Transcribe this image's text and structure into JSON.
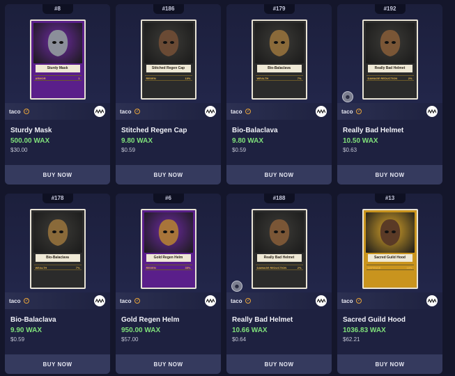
{
  "buy_label": "BUY NOW",
  "collection": "taco",
  "listings": [
    {
      "mint": "#8",
      "title": "Sturdy Mask",
      "price": "500.00 WAX",
      "usd": "$30.00",
      "card_name": "Sturdy Mask",
      "stat_label": "ARMOR",
      "stat_value": "1",
      "card_bg": "#5a1f8a",
      "art_bg": "#6e2aa3",
      "helmet_color": "#8b8f9a",
      "owner_avatar": false
    },
    {
      "mint": "#186",
      "title": "Stitched Regen Cap",
      "price": "9.80 WAX",
      "usd": "$0.59",
      "card_name": "Stitched Regen Cap",
      "stat_label": "REGEN",
      "stat_value": "10%",
      "card_bg": "#2b2b2b",
      "art_bg": "#3d3c38",
      "helmet_color": "#6a4a34",
      "owner_avatar": false
    },
    {
      "mint": "#179",
      "title": "Bio-Balaclava",
      "price": "9.80 WAX",
      "usd": "$0.59",
      "card_name": "Bio-Balaclava",
      "stat_label": "WEALTH",
      "stat_value": "7%",
      "card_bg": "#2b2b2b",
      "art_bg": "#3d3c38",
      "helmet_color": "#8a6a3a",
      "owner_avatar": false
    },
    {
      "mint": "#192",
      "title": "Really Bad Helmet",
      "price": "10.50 WAX",
      "usd": "$0.63",
      "card_name": "Really Bad Helmet",
      "stat_label": "DAMAGE REDUCTION",
      "stat_value": "2%",
      "card_bg": "#2b2b2b",
      "art_bg": "#3d3c38",
      "helmet_color": "#7a5636",
      "owner_avatar": true
    },
    {
      "mint": "#178",
      "title": "Bio-Balaclava",
      "price": "9.90 WAX",
      "usd": "$0.59",
      "card_name": "Bio-Balaclava",
      "stat_label": "WEALTH",
      "stat_value": "7%",
      "card_bg": "#2b2b2b",
      "art_bg": "#3d3c38",
      "helmet_color": "#8a6a3a",
      "owner_avatar": false
    },
    {
      "mint": "#6",
      "title": "Gold Regen Helm",
      "price": "950.00 WAX",
      "usd": "$57.00",
      "card_name": "Gold Regen Helm",
      "stat_label": "REGEN",
      "stat_value": "35%",
      "card_bg": "#5a1f8a",
      "art_bg": "#6e2aa3",
      "helmet_color": "#a8753a",
      "owner_avatar": false
    },
    {
      "mint": "#188",
      "title": "Really Bad Helmet",
      "price": "10.66 WAX",
      "usd": "$0.64",
      "card_name": "Really Bad Helmet",
      "stat_label": "DAMAGE REDUCTION",
      "stat_value": "2%",
      "card_bg": "#2b2b2b",
      "art_bg": "#3d3c38",
      "helmet_color": "#7a5636",
      "owner_avatar": true
    },
    {
      "mint": "#13",
      "title": "Sacred Guild Hood",
      "price": "1036.83 WAX",
      "usd": "$62.21",
      "card_name": "Sacred Guild Hood",
      "stat_label": "DEFENSE",
      "stat_value": "10%",
      "card_bg": "#c9941e",
      "art_bg": "#d9a52a",
      "helmet_color": "#5a3a26",
      "owner_avatar": false
    }
  ]
}
